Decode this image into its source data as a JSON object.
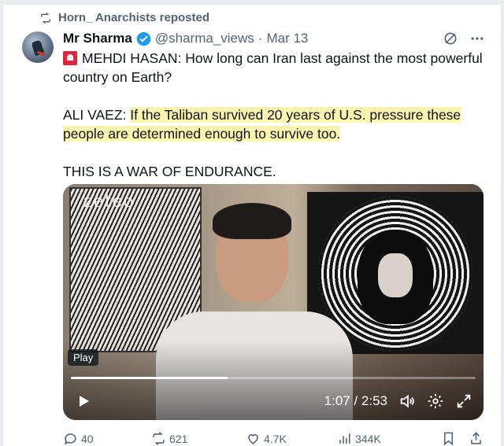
{
  "repost": {
    "label": "Horn_ Anarchists reposted"
  },
  "tweet": {
    "author_name": "Mr Sharma",
    "handle": "@sharma_views",
    "separator": "·",
    "date": "Mar 13",
    "lines": [
      {
        "prefix": "",
        "text": "MEHDI HASAN: How long can Iran last against the most powerful country on Earth?"
      },
      {
        "prefix": "ALI VAEZ: ",
        "text": "If the Taliban survived 20 years of U.S. pressure these people are determined enough to survive too."
      },
      {
        "prefix": "",
        "text": "THIS IS A WAR OF ENDURANCE."
      }
    ]
  },
  "video": {
    "watermark": "zeteo",
    "play_label": "Play",
    "time": "1:07 / 2:53",
    "progress_fraction": 0.387
  },
  "actions": {
    "replies": "40",
    "reposts": "621",
    "likes": "4.7K",
    "views": "344K"
  },
  "colors": {
    "verified": "#1d9bf0",
    "muted": "#536471",
    "highlight": "#fdf4b0"
  }
}
